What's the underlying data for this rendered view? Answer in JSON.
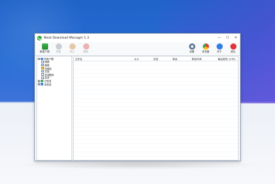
{
  "window": {
    "title": "Neat Download Manager 1.3",
    "controls": {
      "minimize": "—",
      "maximize": "☐",
      "close": "✕"
    }
  },
  "toolbar": {
    "left": [
      {
        "label": "新建下载",
        "icon": "add-download-icon",
        "enabled": true
      },
      {
        "label": "恢复",
        "icon": "resume-icon",
        "enabled": false
      },
      {
        "label": "停止",
        "icon": "stop-icon",
        "enabled": false
      },
      {
        "label": "删除",
        "icon": "delete-icon",
        "enabled": false
      }
    ],
    "right": [
      {
        "label": "设置",
        "icon": "settings-icon"
      },
      {
        "label": "浏览器",
        "icon": "browser-icon"
      },
      {
        "label": "关于",
        "icon": "about-icon"
      },
      {
        "label": "退出",
        "icon": "exit-icon"
      }
    ]
  },
  "tree": {
    "items": [
      {
        "label": "所有下载",
        "expander": "−",
        "level": 0,
        "icon": "folder-icon"
      },
      {
        "label": "视频",
        "level": 1,
        "icon": "video-file-icon"
      },
      {
        "label": "音频",
        "level": 1,
        "icon": "audio-file-icon"
      },
      {
        "label": "压缩包",
        "level": 1,
        "icon": "archive-file-icon"
      },
      {
        "label": "文档",
        "level": 1,
        "icon": "document-file-icon"
      },
      {
        "label": "应用程序",
        "level": 1,
        "icon": "application-file-icon"
      },
      {
        "label": "杂项",
        "level": 1,
        "icon": "misc-file-icon"
      },
      {
        "label": "已完成",
        "expander": "+",
        "level": 0,
        "icon": "folder-icon"
      },
      {
        "label": "未完成",
        "expander": "+",
        "level": 0,
        "icon": "folder-icon"
      }
    ]
  },
  "list": {
    "columns": [
      "文件名",
      "大小",
      "状态",
      "剩余",
      "剩余时间",
      "最后更改 (小时)"
    ]
  }
}
